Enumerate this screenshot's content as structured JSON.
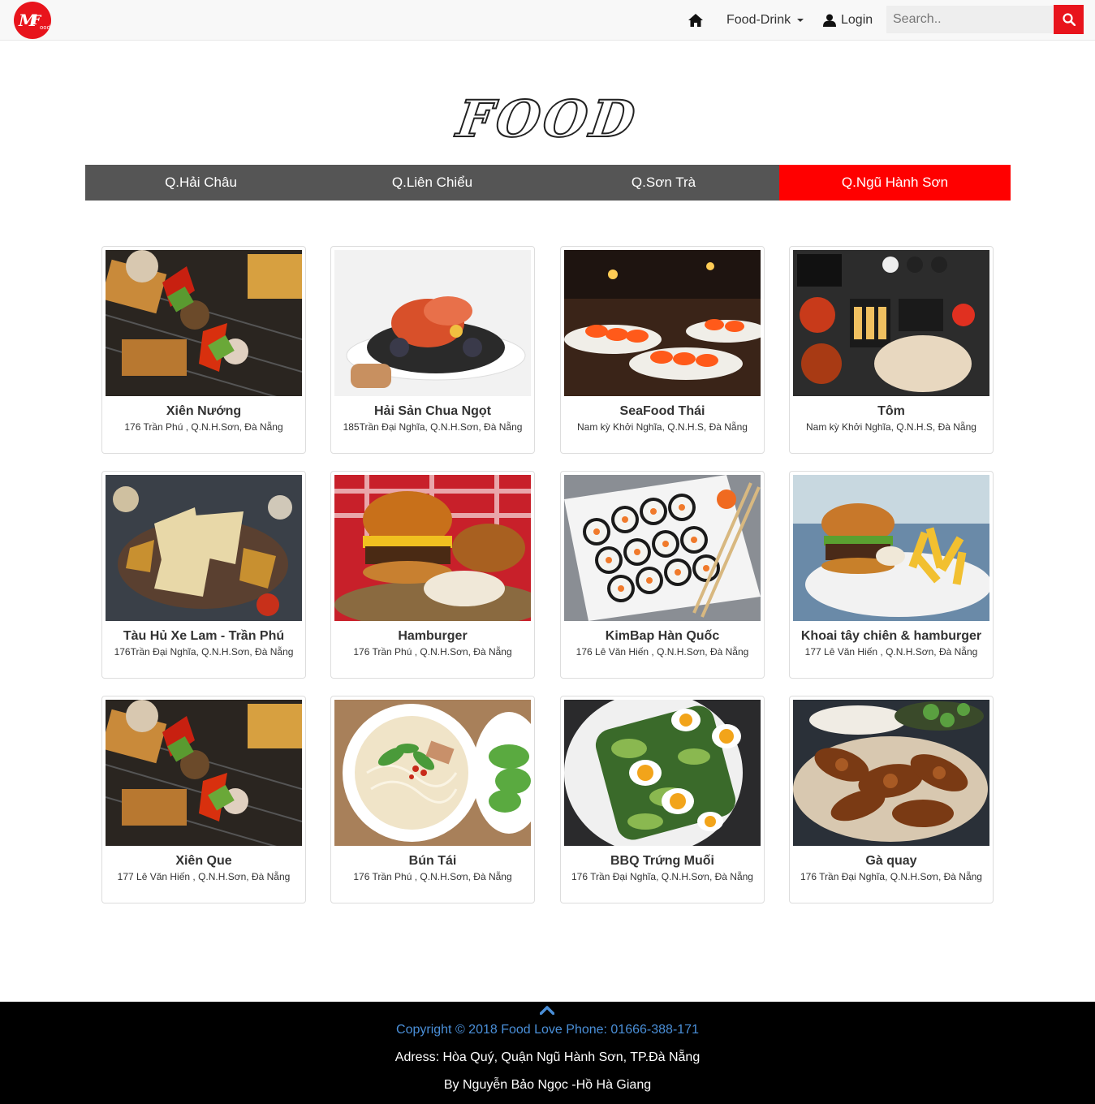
{
  "navbar": {
    "logo_text": "MFood",
    "home_icon": "home-icon",
    "menu_label": "Food-Drink",
    "login_label": "Login",
    "login_icon": "user-icon",
    "search_placeholder": "Search..",
    "search_icon": "search-icon",
    "accent_color": "#e8141c"
  },
  "page": {
    "title": "FOOD"
  },
  "tabs": [
    {
      "label": "Q.Hải Châu",
      "active": false
    },
    {
      "label": "Q.Liên Chiểu",
      "active": false
    },
    {
      "label": "Q.Sơn Trà",
      "active": false
    },
    {
      "label": "Q.Ngũ Hành Sơn",
      "active": true
    }
  ],
  "cards": [
    {
      "name": "Xiên Nướng",
      "address": "176 Trần Phú , Q.N.H.Sơn, Đà Nẵng",
      "image": "grilled-skewers"
    },
    {
      "name": "Hải Sản Chua Ngọt",
      "address": "185Trần Đại Nghĩa, Q.N.H.Sơn, Đà Nẵng",
      "image": "seafood-platter"
    },
    {
      "name": "SeaFood Thái",
      "address": "Nam kỳ Khởi Nghĩa, Q.N.H.S, Đà Nẵng",
      "image": "shrimp-buffet"
    },
    {
      "name": "Tôm",
      "address": "Nam kỳ Khởi Nghĩa, Q.N.H.S, Đà Nẵng",
      "image": "food-spread"
    },
    {
      "name": "Tàu Hủ Xe Lam - Trần Phú",
      "address": "176Trần Đại Nghĩa, Q.N.H.Sơn, Đà Nẵng",
      "image": "nachos"
    },
    {
      "name": "Hamburger",
      "address": "176 Trần Phú , Q.N.H.Sơn, Đà Nẵng",
      "image": "hamburger"
    },
    {
      "name": "KimBap Hàn Quốc",
      "address": "176 Lê Văn Hiến , Q.N.H.Sơn, Đà Nẵng",
      "image": "sushi-rolls"
    },
    {
      "name": "Khoai tây chiên & hamburger",
      "address": "177 Lê Văn Hiến , Q.N.H.Sơn, Đà Nẵng",
      "image": "burger-fries"
    },
    {
      "name": "Xiên Que",
      "address": "177 Lê Văn Hiến , Q.N.H.Sơn, Đà Nẵng",
      "image": "grilled-skewers"
    },
    {
      "name": "Bún Tái",
      "address": "176 Trần Phú , Q.N.H.Sơn, Đà Nẵng",
      "image": "noodle-soup"
    },
    {
      "name": "BBQ Trứng Muối",
      "address": "176 Trần Đại Nghĩa, Q.N.H.Sơn, Đà Nẵng",
      "image": "eggs-avocado"
    },
    {
      "name": "Gà quay",
      "address": "176 Trần Đại Nghĩa, Q.N.H.Sơn, Đà Nẵng",
      "image": "roast-chicken"
    }
  ],
  "footer": {
    "back_to_top_icon": "chevron-up-icon",
    "copyright": "Copyright © 2018 Food Love Phone: 01666-388-171",
    "address": "Adress: Hòa Quý, Quận Ngũ Hành Sơn, TP.Đà Nẵng",
    "credits": "By Nguyễn Bảo Ngọc -Hồ Hà Giang"
  }
}
